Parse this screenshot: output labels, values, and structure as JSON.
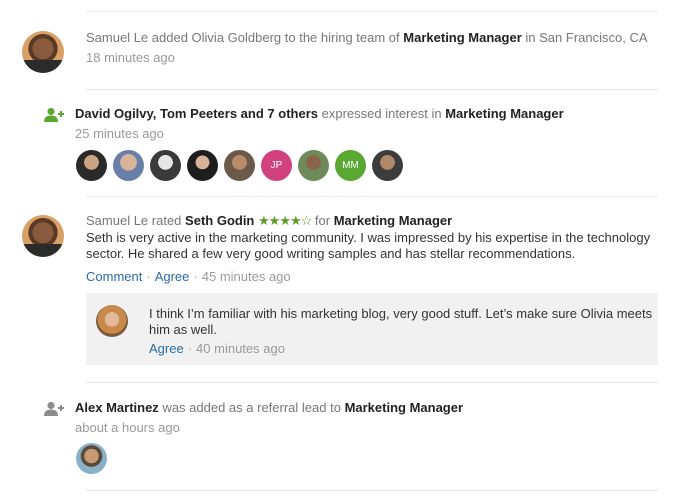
{
  "feed": {
    "item1": {
      "actor": "Samuel Le",
      "action": "added Olivia Goldberg to the hiring team of",
      "target": "Marketing Manager",
      "location_prefix": "in",
      "location": "San Francisco, CA",
      "time": "18 minutes ago"
    },
    "item2": {
      "icon": "person-add-icon",
      "actors": "David Ogilvy, Tom Peeters and 7 others",
      "action": "expressed interest in",
      "target": "Marketing Manager",
      "time": "25 minutes ago",
      "avatars": [
        {
          "kind": "photo"
        },
        {
          "kind": "photo"
        },
        {
          "kind": "photo"
        },
        {
          "kind": "photo"
        },
        {
          "kind": "photo"
        },
        {
          "kind": "initials",
          "text": "JP",
          "color": "#d0417e"
        },
        {
          "kind": "photo"
        },
        {
          "kind": "initials",
          "text": "MM",
          "color": "#5aa832"
        },
        {
          "kind": "photo"
        }
      ]
    },
    "item3": {
      "actor": "Samuel Le",
      "action": "rated",
      "subject": "Seth Godin",
      "stars": "★★★★☆",
      "rating": 4,
      "for_text": "for",
      "target": "Marketing Manager",
      "comment_line1": "Seth is very active in the marketing community. I was impressed by his expertise in the technology",
      "comment_line2": "sector. He shared a few very good writing samples and has stellar recommendations.",
      "comment_action": "Comment",
      "agree_action": "Agree",
      "time": "45 minutes ago",
      "reply": {
        "line1": "I think I’m familiar with his marketing blog, very good stuff. Let’s make sure Olivia meets",
        "line2": "him as well.",
        "agree_action": "Agree",
        "time": "40 minutes ago"
      }
    },
    "item4": {
      "icon": "person-add-icon",
      "actor": "Alex Martinez",
      "action": "was added as a referral lead to",
      "target": "Marketing Manager",
      "time": "about a hours ago"
    }
  },
  "colors": {
    "link": "#2b6aa8",
    "star": "#5a9a2a",
    "icon_green": "#5aa832",
    "icon_grey": "#8c8c8c"
  }
}
